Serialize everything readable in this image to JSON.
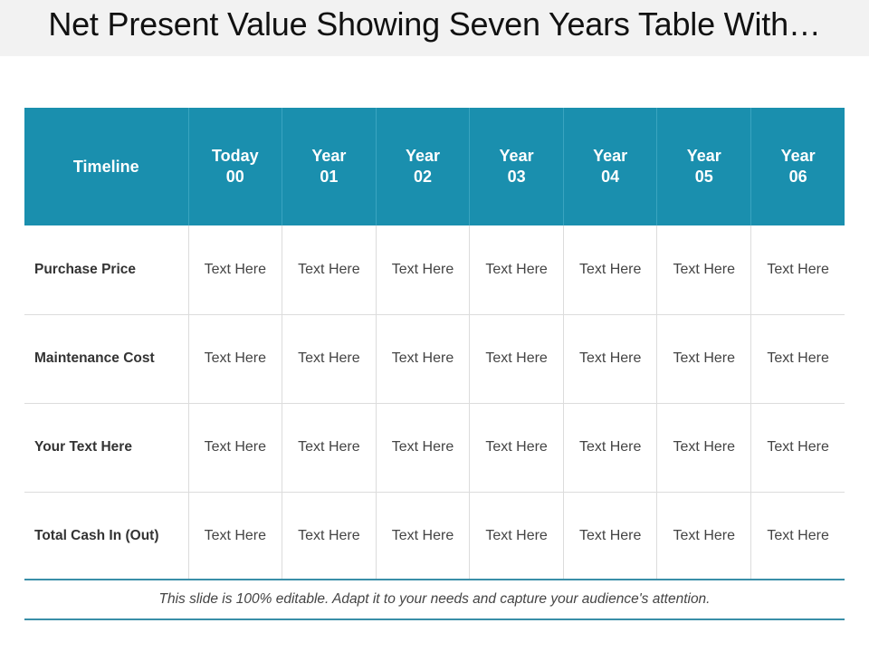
{
  "title": "Net Present Value Showing Seven Years Table With…",
  "colors": {
    "header_bg": "#1a8fae",
    "header_text": "#ffffff",
    "rule": "#3a8fa8",
    "title_bar_bg": "#f2f2f2"
  },
  "table": {
    "header": {
      "label": "Timeline",
      "columns": [
        {
          "line1": "Today",
          "line2": "00"
        },
        {
          "line1": "Year",
          "line2": "01"
        },
        {
          "line1": "Year",
          "line2": "02"
        },
        {
          "line1": "Year",
          "line2": "03"
        },
        {
          "line1": "Year",
          "line2": "04"
        },
        {
          "line1": "Year",
          "line2": "05"
        },
        {
          "line1": "Year",
          "line2": "06"
        }
      ]
    },
    "rows": [
      {
        "label": "Purchase Price",
        "cells": [
          "Text Here",
          "Text Here",
          "Text Here",
          "Text Here",
          "Text Here",
          "Text Here",
          "Text Here"
        ]
      },
      {
        "label": "Maintenance Cost",
        "cells": [
          "Text Here",
          "Text Here",
          "Text Here",
          "Text Here",
          "Text Here",
          "Text Here",
          "Text Here"
        ]
      },
      {
        "label": "Your Text Here",
        "cells": [
          "Text Here",
          "Text Here",
          "Text Here",
          "Text Here",
          "Text Here",
          "Text Here",
          "Text Here"
        ]
      },
      {
        "label": "Total Cash In (Out)",
        "cells": [
          "Text Here",
          "Text Here",
          "Text Here",
          "Text Here",
          "Text Here",
          "Text Here",
          "Text Here"
        ]
      }
    ]
  },
  "caption": "This slide is 100% editable. Adapt it to your needs and capture your audience's attention."
}
